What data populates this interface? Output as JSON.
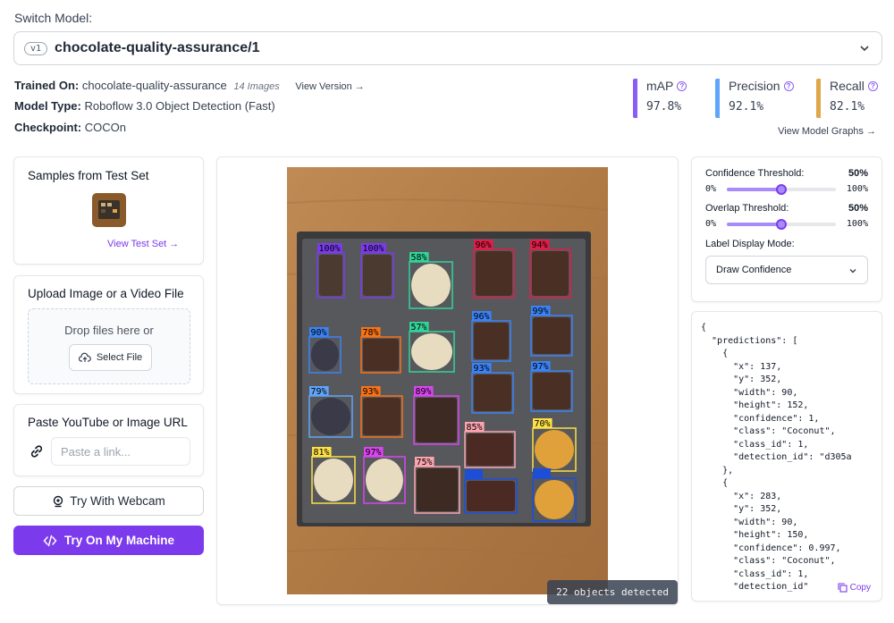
{
  "switch_model": {
    "label": "Switch Model:",
    "version": "v1",
    "model_name": "chocolate-quality-assurance/1"
  },
  "meta": {
    "trained_on_label": "Trained On:",
    "trained_on_value": "chocolate-quality-assurance",
    "images_count": "14 Images",
    "view_version": "View Version →",
    "model_type_label": "Model Type:",
    "model_type_value": "Roboflow 3.0 Object Detection (Fast)",
    "checkpoint_label": "Checkpoint:",
    "checkpoint_value": "COCOn"
  },
  "metrics": [
    {
      "label": "mAP",
      "value": "97.8%",
      "color": "#8b5cf6"
    },
    {
      "label": "Precision",
      "value": "92.1%",
      "color": "#60a5fa"
    },
    {
      "label": "Recall",
      "value": "82.1%",
      "color": "#e0a64a"
    }
  ],
  "view_model_graphs": "View Model Graphs →",
  "samples": {
    "title": "Samples from Test Set",
    "view_test_set": "View Test Set →"
  },
  "upload": {
    "title": "Upload Image or a Video File",
    "drop_text": "Drop files here or",
    "select_file": "Select File"
  },
  "paste_url": {
    "title": "Paste YouTube or Image URL",
    "placeholder": "Paste a link..."
  },
  "buttons": {
    "webcam": "Try With Webcam",
    "machine": "Try On My Machine"
  },
  "detections": [
    {
      "label": "100%",
      "color": "#7c3aed"
    },
    {
      "label": "100%",
      "color": "#7c3aed"
    },
    {
      "label": "58%",
      "color": "#34d399"
    },
    {
      "label": "96%",
      "color": "#e11d48"
    },
    {
      "label": "94%",
      "color": "#e11d48"
    },
    {
      "label": "90%",
      "color": "#3b82f6"
    },
    {
      "label": "78%",
      "color": "#f97316"
    },
    {
      "label": "57%",
      "color": "#34d399"
    },
    {
      "label": "96%",
      "color": "#3b82f6"
    },
    {
      "label": "99%",
      "color": "#3b82f6"
    },
    {
      "label": "93%",
      "color": "#3b82f6"
    },
    {
      "label": "97%",
      "color": "#3b82f6"
    },
    {
      "label": "79%",
      "color": "#60a5fa"
    },
    {
      "label": "93%",
      "color": "#f97316"
    },
    {
      "label": "89%",
      "color": "#d946ef"
    },
    {
      "label": "85%",
      "color": "#fda4af"
    },
    {
      "label": "70%",
      "color": "#fde047"
    },
    {
      "label": "81%",
      "color": "#fde047"
    },
    {
      "label": "97%",
      "color": "#d946ef"
    },
    {
      "label": "75%",
      "color": "#fda4af"
    },
    {
      "label": "",
      "color": "#1d4ed8"
    },
    {
      "label": "",
      "color": "#1d4ed8"
    }
  ],
  "objects_detected": "22 objects detected",
  "settings": {
    "confidence_label": "Confidence Threshold:",
    "confidence_value": "50%",
    "overlap_label": "Overlap Threshold:",
    "overlap_value": "50%",
    "min": "0%",
    "max": "100%",
    "confidence_level": 50,
    "overlap_level": 50,
    "label_mode_label": "Label Display Mode:",
    "label_mode_value": "Draw Confidence"
  },
  "json_output": "{\n  \"predictions\": [\n    {\n      \"x\": 137,\n      \"y\": 352,\n      \"width\": 90,\n      \"height\": 152,\n      \"confidence\": 1,\n      \"class\": \"Coconut\",\n      \"class_id\": 1,\n      \"detection_id\": \"d305a\n    },\n    {\n      \"x\": 283,\n      \"y\": 352,\n      \"width\": 90,\n      \"height\": 150,\n      \"confidence\": 0.997,\n      \"class\": \"Coconut\",\n      \"class_id\": 1,\n      \"detection_id\"",
  "copy_label": "Copy"
}
